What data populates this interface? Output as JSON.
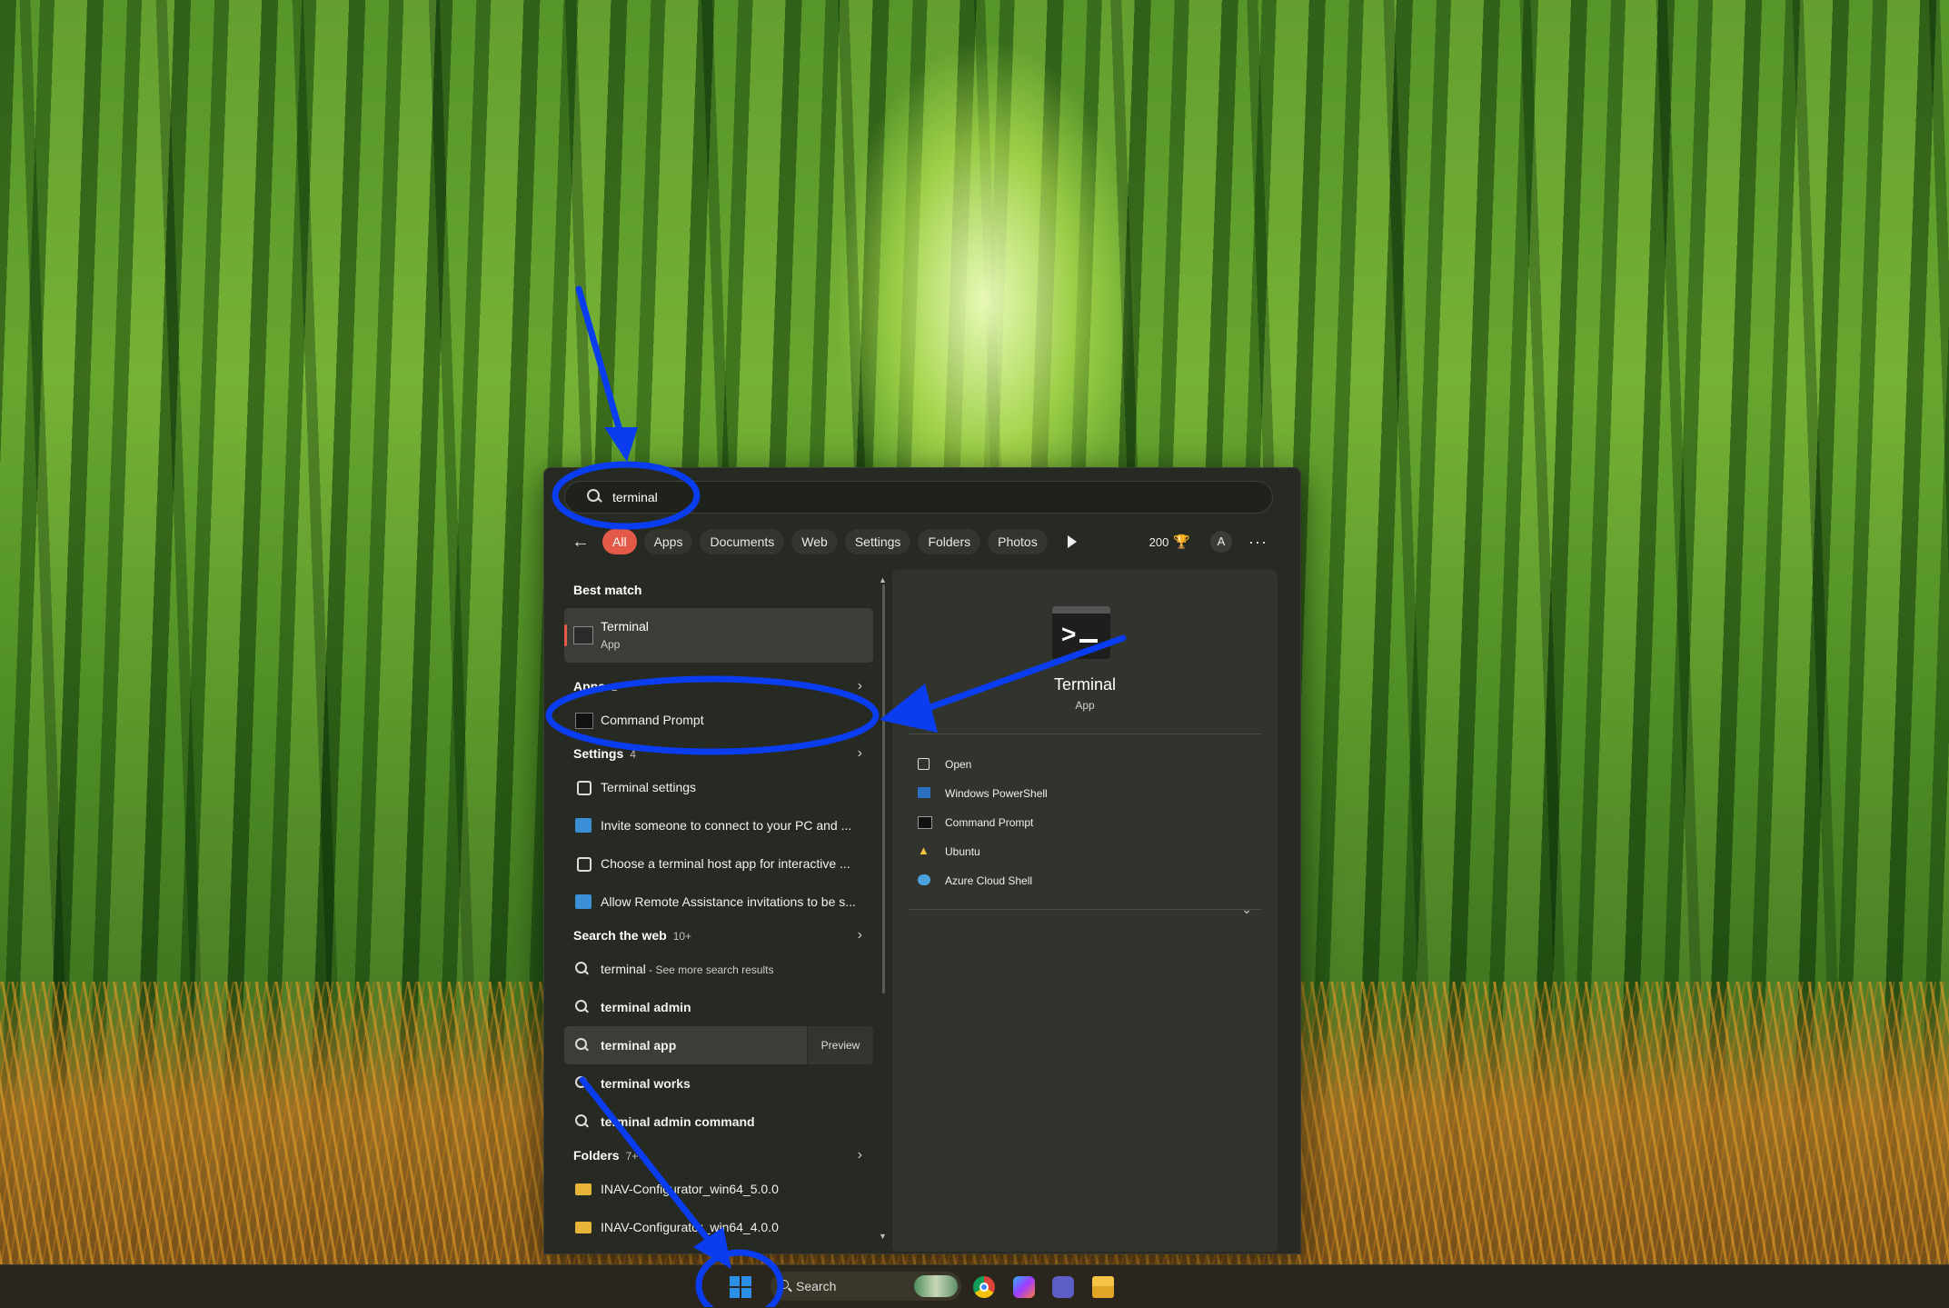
{
  "search": {
    "value": "terminal",
    "placeholder": ""
  },
  "filters": {
    "chips": [
      "All",
      "Apps",
      "Documents",
      "Web",
      "Settings",
      "Folders",
      "Photos"
    ],
    "points": "200",
    "avatar_letter": "A",
    "more": "···"
  },
  "results": {
    "best_match_label": "Best match",
    "best_match": {
      "title": "Terminal",
      "subtitle": "App"
    },
    "apps_label": "Apps",
    "apps_count": "2",
    "apps": [
      "Command Prompt"
    ],
    "settings_label": "Settings",
    "settings_count": "4",
    "settings": [
      "Terminal settings",
      "Invite someone to connect to your PC and ...",
      "Choose a terminal host app for interactive ...",
      "Allow Remote Assistance invitations to be s..."
    ],
    "web_label": "Search the web",
    "web_count": "10+",
    "web": [
      {
        "bold": "terminal",
        "light": " - See more search results"
      },
      {
        "bold": "terminal admin",
        "light": ""
      },
      {
        "bold": "terminal app",
        "light": "",
        "preview": "Preview"
      },
      {
        "bold": "terminal works",
        "light": ""
      },
      {
        "bold": "terminal admin command",
        "light": ""
      }
    ],
    "folders_label": "Folders",
    "folders_count": "7+",
    "folders": [
      "INAV-Configurator_win64_5.0.0",
      "INAV-Configurator_win64_4.0.0"
    ]
  },
  "detail": {
    "title": "Terminal",
    "subtitle": "App",
    "actions": [
      "Open",
      "Windows PowerShell",
      "Command Prompt",
      "Ubuntu",
      "Azure Cloud Shell"
    ]
  },
  "taskbar": {
    "search_label": "Search"
  },
  "colors": {
    "accent": "#e35a48",
    "annotation": "#0a3cf0",
    "flyout_bg": "#272a22"
  }
}
